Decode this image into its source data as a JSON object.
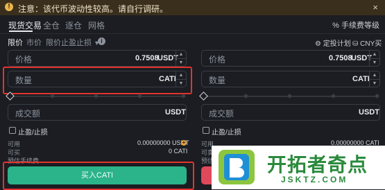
{
  "notice": {
    "text": "注意：该代币波动性较高。请自行调研。",
    "close": "×"
  },
  "tabs": [
    "现货交易",
    "全仓",
    "逐仓",
    "网格"
  ],
  "fee_link": "手续费等级",
  "order_types": {
    "limit": "限价",
    "market": "市价",
    "stop": "限价止盈止损"
  },
  "plan_label": "定投计划",
  "cny_label": "CNY买币",
  "buy_form": {
    "price_label": "价格",
    "price_value": "0.7508",
    "price_unit": "USDT",
    "amount_label": "数量",
    "amount_unit": "CATI",
    "total_label": "成交额",
    "total_unit": "USDT",
    "tp_sl_label": "止盈/止损",
    "available_label": "可用",
    "available_value": "0.00000000 USDT",
    "can_buy_label": "可买",
    "can_buy_value": "0 CATI",
    "fee_label": "预估手续费",
    "submit": "买入CATI"
  },
  "sell_form": {
    "price_label": "价格",
    "price_value": "0.7508",
    "price_unit": "USDT",
    "amount_label": "数量",
    "amount_unit": "CATI",
    "total_label": "成交额",
    "total_unit": "USDT",
    "tp_sl_label": "止盈/止损",
    "available_label": "可用",
    "available_value": "0.00000000 CATI",
    "can_sell_label": "可卖",
    "fee_label": "预估"
  },
  "watermark": {
    "brand": "开拓者奇点",
    "url": "JSKTZ.COM",
    "logo_letter": "B"
  },
  "colors": {
    "buy": "#2bb38a",
    "sell": "#e0495b",
    "highlight": "#e4342f",
    "warning": "#e9b44c"
  }
}
